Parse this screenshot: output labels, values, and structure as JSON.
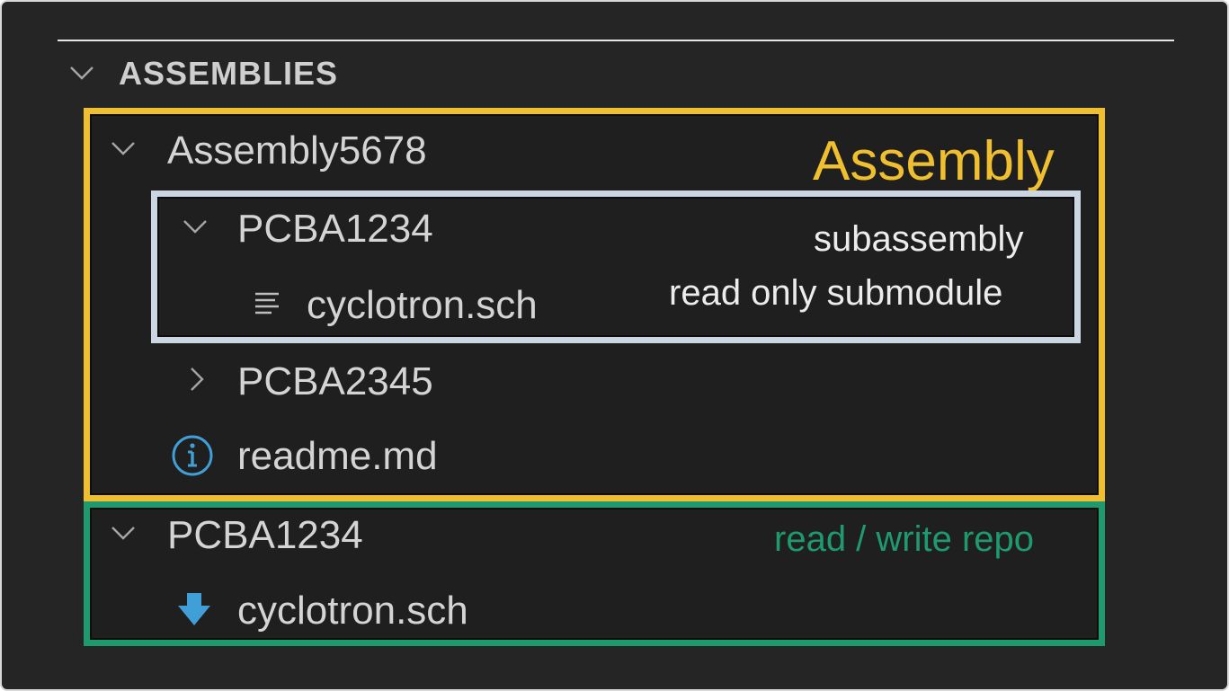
{
  "section": {
    "title": "ASSEMBLIES"
  },
  "tree": {
    "assembly": {
      "label": "Assembly5678"
    },
    "subassembly": {
      "label": "PCBA1234"
    },
    "sub_file": {
      "label": "cyclotron.sch",
      "icon": "list-lines-icon"
    },
    "pcba2345": {
      "label": "PCBA2345"
    },
    "readme": {
      "label": "readme.md",
      "icon": "info-icon"
    },
    "repo": {
      "label": "PCBA1234"
    },
    "repo_file": {
      "label": "cyclotron.sch",
      "icon": "download-arrow-icon"
    }
  },
  "annotations": {
    "assembly": {
      "text": "Assembly",
      "color": "#f0bf30"
    },
    "subassembly_line1": "subassembly",
    "subassembly_line2": "read only submodule",
    "subassembly_color": "#ccd6e2",
    "repo": {
      "text": "read / write repo",
      "color": "#1f9a6f"
    }
  },
  "colors": {
    "background": "#252526",
    "text": "#d4d4d4",
    "info_icon": "#3f9fd6",
    "download_icon": "#3f9fd6"
  }
}
